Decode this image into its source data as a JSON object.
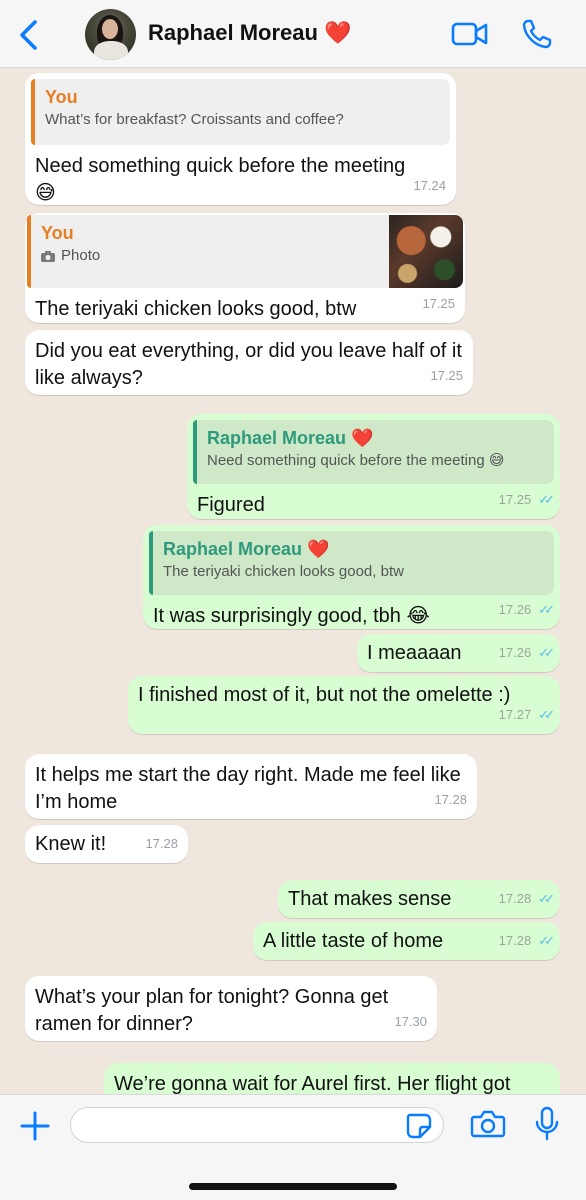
{
  "header": {
    "contact_name": "Raphael Moreau",
    "contact_emoji": "❤️",
    "back_icon": "chevron-left-icon",
    "video_icon": "video-camera-icon",
    "call_icon": "phone-icon"
  },
  "colors": {
    "accent_blue": "#0a7cff",
    "incoming_bubble": "#ffffff",
    "outgoing_bubble": "#d9fdd3",
    "quote_orange": "#e67e22",
    "quote_green": "#2e9a7c",
    "read_ticks": "#53bdeb"
  },
  "messages": [
    {
      "direction": "in",
      "reply": {
        "author": "You",
        "text": "What’s for breakfast? Croissants and coffee?"
      },
      "text": "Need something quick before the meeting",
      "emoji": "😅",
      "time": "17.24"
    },
    {
      "direction": "in",
      "reply": {
        "author": "You",
        "text": "Photo"
      },
      "text": "The teriyaki chicken looks good, btw",
      "time": "17.25"
    },
    {
      "direction": "in",
      "text": "Did you eat everything, or did you leave half of it like always?",
      "time": "17.25"
    },
    {
      "direction": "out",
      "reply": {
        "author": "Raphael Moreau",
        "author_emoji": "❤️",
        "text": "Need something quick before the meeting 😅"
      },
      "text": "Figured",
      "time": "17.25"
    },
    {
      "direction": "out",
      "reply": {
        "author": "Raphael Moreau",
        "author_emoji": "❤️",
        "text": "The teriyaki chicken looks good, btw"
      },
      "text": "It was surprisingly good, tbh 😂",
      "time": "17.26"
    },
    {
      "direction": "out",
      "text": "I meaaaan",
      "time": "17.26"
    },
    {
      "direction": "out",
      "text": "I finished most of it, but not the omelette :)",
      "time": "17.27"
    },
    {
      "direction": "in",
      "text": "It helps me start the day right. Made me feel like I’m home",
      "time": "17.28"
    },
    {
      "direction": "in",
      "text": "Knew it!",
      "time": "17.28"
    },
    {
      "direction": "out",
      "text": "That makes sense",
      "time": "17.28"
    },
    {
      "direction": "out",
      "text": "A little taste of home",
      "time": "17.28"
    },
    {
      "direction": "in",
      "text": "What’s your plan for tonight? Gonna get ramen for dinner?",
      "time": "17.30"
    },
    {
      "direction": "out",
      "text": "We’re gonna wait for Aurel first. Her flight got"
    }
  ],
  "composer": {
    "placeholder": "",
    "plus_icon": "plus-icon",
    "sticker_icon": "sticker-icon",
    "camera_icon": "camera-icon",
    "mic_icon": "microphone-icon"
  }
}
